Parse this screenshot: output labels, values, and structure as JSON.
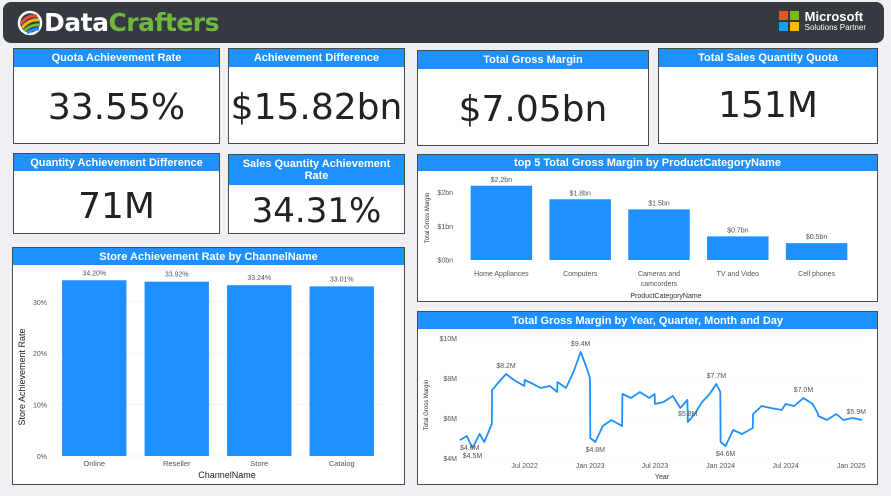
{
  "header": {
    "logo_part1": "Data",
    "logo_part2": "Crafters",
    "partner_name": "Microsoft",
    "partner_sub": "Solutions Partner",
    "ms_colors": [
      "#f25022",
      "#7fba00",
      "#00a4ef",
      "#ffb900"
    ]
  },
  "colors": {
    "accent": "#1e90ff",
    "bar": "#1e90ff",
    "line": "#1e90ff"
  },
  "kpis": {
    "quota_achievement_rate": {
      "title": "Quota Achievement Rate",
      "value": "33.55%"
    },
    "achievement_difference": {
      "title": "Achievement Difference",
      "value": "$15.82bn"
    },
    "total_gross_margin": {
      "title": "Total Gross Margin",
      "value": "$7.05bn"
    },
    "total_sales_quantity_quota": {
      "title": "Total Sales Quantity Quota",
      "value": "151M"
    },
    "quantity_achievement_difference": {
      "title": "Quantity Achievement Difference",
      "value": "71M"
    },
    "sales_quantity_achievement_rate": {
      "title": "Sales Quantity Achievement Rate",
      "value": "34.31%"
    }
  },
  "chart_data": [
    {
      "id": "top5",
      "type": "bar",
      "title": "top 5 Total Gross Margin by ProductCategoryName",
      "xlabel": "ProductCategoryName",
      "ylabel": "Total Gross Margin",
      "categories": [
        "Home Appliances",
        "Computers",
        "Cameras and camcorders",
        "TV and Video",
        "Cell phones"
      ],
      "category_lines": [
        [
          "Home Appliances"
        ],
        [
          "Computers"
        ],
        [
          "Cameras and",
          "camcorders"
        ],
        [
          "TV and Video"
        ],
        [
          "Cell phones"
        ]
      ],
      "values": [
        2.2,
        1.8,
        1.5,
        0.7,
        0.5
      ],
      "data_labels": [
        "$2.2bn",
        "$1.8bn",
        "$1.5bn",
        "$0.7bn",
        "$0.5bn"
      ],
      "yticks": [
        0,
        1,
        2
      ],
      "ytick_labels": [
        "$0bn",
        "$1bn",
        "$2bn"
      ],
      "ylim": [
        0,
        2.4
      ]
    },
    {
      "id": "store",
      "type": "bar",
      "title": "Store Achievement Rate by ChannelName",
      "xlabel": "ChannelName",
      "ylabel": "Store Achievement Rate",
      "categories": [
        "Online",
        "Reseller",
        "Store",
        "Catalog"
      ],
      "values": [
        34.2,
        33.92,
        33.24,
        33.01
      ],
      "data_labels": [
        "34.20%",
        "33.92%",
        "33.24%",
        "33.01%"
      ],
      "yticks": [
        0,
        10,
        20,
        30
      ],
      "ytick_labels": [
        "0%",
        "10%",
        "20%",
        "30%"
      ],
      "ylim": [
        0,
        36
      ]
    },
    {
      "id": "trend",
      "type": "line",
      "title": "Total Gross Margin by Year, Quarter, Month and Day",
      "xlabel": "Year",
      "ylabel": "Total Gross Margin",
      "x_start": "2022-01-01",
      "x_end": "2025-01-31",
      "yticks": [
        4,
        6,
        8,
        10
      ],
      "ytick_labels": [
        "$4M",
        "$6M",
        "$8M",
        "$10M"
      ],
      "ylim": [
        4,
        10
      ],
      "xticks": [
        "2022-07-01",
        "2023-01-01",
        "2023-07-01",
        "2024-01-01",
        "2024-07-01",
        "2025-01-01"
      ],
      "xtick_labels": [
        "Jul 2022",
        "Jan 2023",
        "Jul 2023",
        "Jan 2024",
        "Jul 2024",
        "Jan 2025"
      ],
      "points": [
        [
          "2022-01-01",
          4.9
        ],
        [
          "2022-01-20",
          5.1
        ],
        [
          "2022-02-05",
          4.5
        ],
        [
          "2022-02-25",
          5.2
        ],
        [
          "2022-03-10",
          4.8
        ],
        [
          "2022-03-31",
          5.7
        ],
        [
          "2022-04-01",
          7.4
        ],
        [
          "2022-04-20",
          7.8
        ],
        [
          "2022-05-10",
          8.2
        ],
        [
          "2022-06-01",
          7.9
        ],
        [
          "2022-06-30",
          7.6
        ],
        [
          "2022-07-01",
          7.9
        ],
        [
          "2022-07-25",
          7.7
        ],
        [
          "2022-08-15",
          7.5
        ],
        [
          "2022-09-10",
          7.6
        ],
        [
          "2022-09-30",
          7.3
        ],
        [
          "2022-10-01",
          7.8
        ],
        [
          "2022-10-25",
          7.5
        ],
        [
          "2022-11-15",
          8.3
        ],
        [
          "2022-12-05",
          9.3
        ],
        [
          "2022-12-20",
          8.6
        ],
        [
          "2022-12-31",
          8.0
        ],
        [
          "2023-01-01",
          5.0
        ],
        [
          "2023-01-15",
          4.8
        ],
        [
          "2023-02-05",
          5.6
        ],
        [
          "2023-03-01",
          5.9
        ],
        [
          "2023-03-31",
          5.6
        ],
        [
          "2023-04-01",
          7.2
        ],
        [
          "2023-04-25",
          7.0
        ],
        [
          "2023-05-20",
          7.3
        ],
        [
          "2023-06-15",
          7.0
        ],
        [
          "2023-06-30",
          7.2
        ],
        [
          "2023-07-01",
          6.7
        ],
        [
          "2023-07-25",
          6.8
        ],
        [
          "2023-08-20",
          7.1
        ],
        [
          "2023-09-10",
          6.5
        ],
        [
          "2023-09-30",
          6.9
        ],
        [
          "2023-10-01",
          5.8
        ],
        [
          "2023-10-20",
          6.2
        ],
        [
          "2023-11-10",
          6.8
        ],
        [
          "2023-12-01",
          7.2
        ],
        [
          "2023-12-20",
          7.7
        ],
        [
          "2023-12-31",
          7.3
        ],
        [
          "2024-01-01",
          4.8
        ],
        [
          "2024-01-15",
          4.6
        ],
        [
          "2024-02-05",
          5.4
        ],
        [
          "2024-03-01",
          5.2
        ],
        [
          "2024-03-31",
          5.5
        ],
        [
          "2024-04-01",
          6.2
        ],
        [
          "2024-04-25",
          6.6
        ],
        [
          "2024-05-20",
          6.5
        ],
        [
          "2024-06-20",
          6.4
        ],
        [
          "2024-07-01",
          6.7
        ],
        [
          "2024-07-25",
          6.6
        ],
        [
          "2024-08-20",
          7.0
        ],
        [
          "2024-09-15",
          6.7
        ],
        [
          "2024-09-30",
          6.2
        ],
        [
          "2024-10-01",
          6.1
        ],
        [
          "2024-10-25",
          5.9
        ],
        [
          "2024-11-20",
          6.2
        ],
        [
          "2024-12-10",
          5.9
        ],
        [
          "2025-01-05",
          6.0
        ],
        [
          "2025-01-31",
          5.9
        ]
      ],
      "annotations": [
        {
          "x": "2022-01-01",
          "y": 4.9,
          "text": "$4.6M"
        },
        {
          "x": "2022-02-05",
          "y": 4.5,
          "text": "$4.5M"
        },
        {
          "x": "2022-05-10",
          "y": 8.2,
          "text": "$8.2M"
        },
        {
          "x": "2022-12-05",
          "y": 9.3,
          "text": "$9.4M"
        },
        {
          "x": "2023-01-15",
          "y": 4.8,
          "text": "$4.8M"
        },
        {
          "x": "2023-10-01",
          "y": 5.8,
          "text": "$5.8M"
        },
        {
          "x": "2023-12-20",
          "y": 7.7,
          "text": "$7.7M"
        },
        {
          "x": "2024-01-15",
          "y": 4.6,
          "text": "$4.6M"
        },
        {
          "x": "2024-08-20",
          "y": 7.0,
          "text": "$7.0M"
        },
        {
          "x": "2025-01-31",
          "y": 5.9,
          "text": "$5.9M"
        }
      ]
    }
  ]
}
